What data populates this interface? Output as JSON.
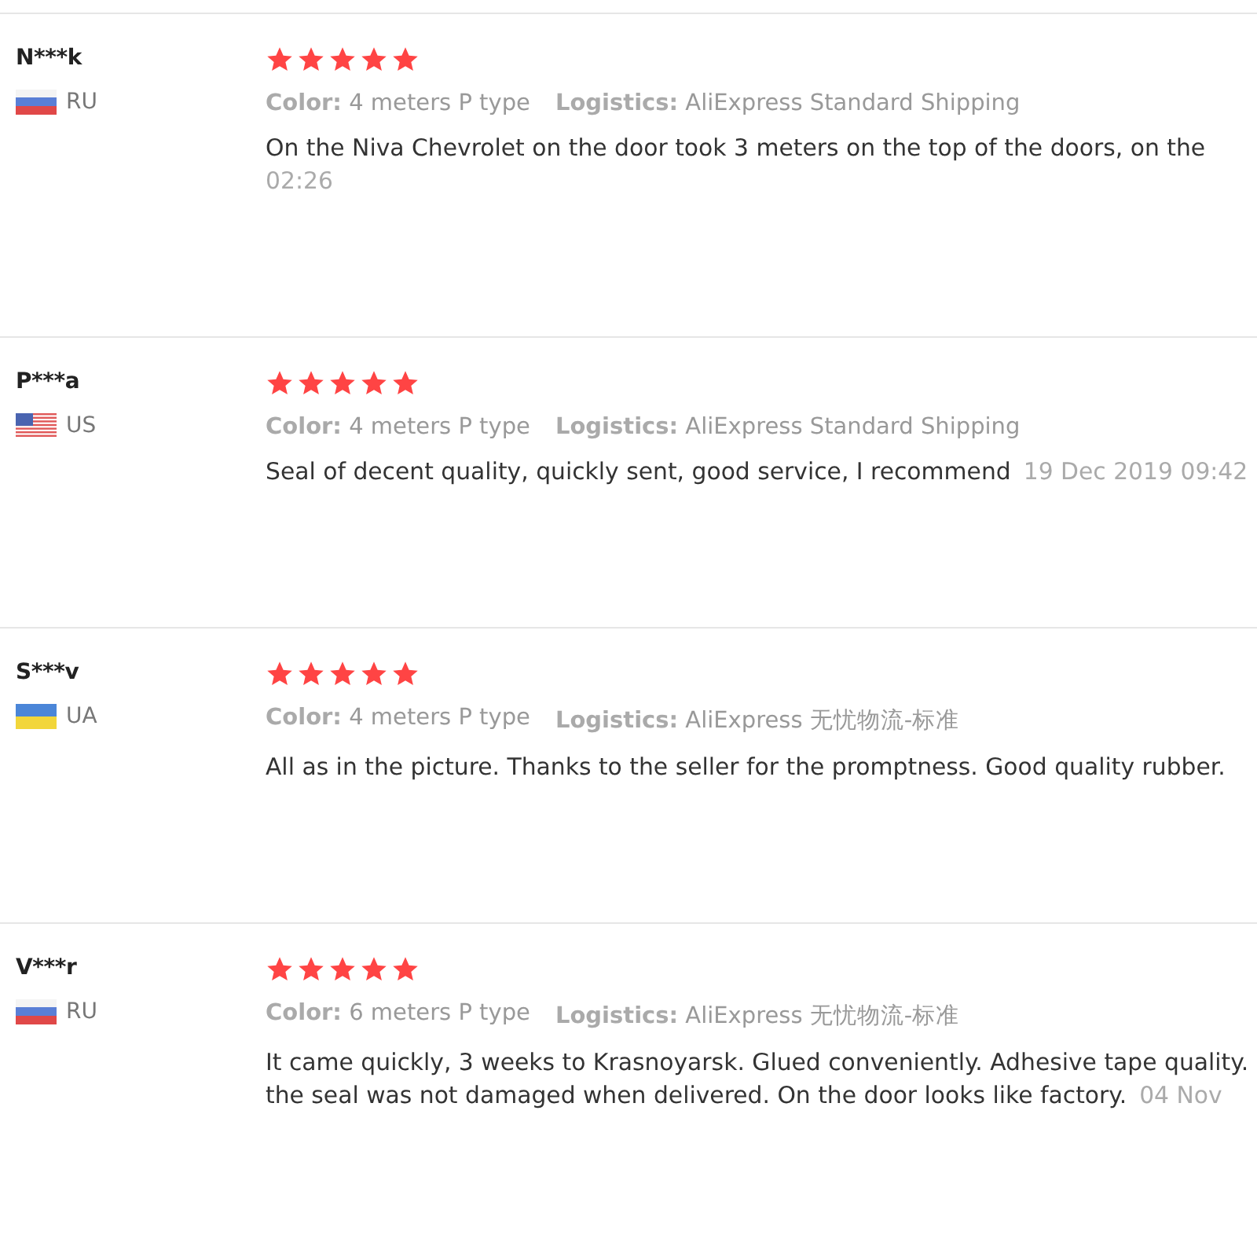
{
  "reviews": [
    {
      "name": "N***k",
      "kind": "ru",
      "country": "RU",
      "stars": 5,
      "color_label": "Color:",
      "color_value": "4 meters P type",
      "logistics_label": "Logistics:",
      "logistics_value": "AliExpress Standard Shipping",
      "lines": [
        [
          {
            "kind": "text",
            "text": "On the Niva Chevrolet on the door took 3 meters on the top of the doors, on the"
          }
        ],
        [
          {
            "kind": "date",
            "text": "02:26"
          }
        ]
      ]
    },
    {
      "name": "P***a",
      "kind": "us",
      "country": "US",
      "stars": 5,
      "color_label": "Color:",
      "color_value": "4 meters P type",
      "logistics_label": "Logistics:",
      "logistics_value": "AliExpress Standard Shipping",
      "lines": [
        [
          {
            "kind": "text",
            "text": "Seal of decent quality, quickly sent, good service, I recommend"
          },
          {
            "kind": "date",
            "text": "19 Dec 2019 09:42"
          }
        ]
      ]
    },
    {
      "name": "S***v",
      "kind": "ua",
      "country": "UA",
      "stars": 5,
      "color_label": "Color:",
      "color_value": "4 meters P type",
      "logistics_label": "Logistics:",
      "logistics_value": "AliExpress 无忧物流-标准",
      "lines": [
        [
          {
            "kind": "text",
            "text": "All as in the picture. Thanks to the seller for the promptness. Good quality rubber."
          }
        ]
      ]
    },
    {
      "name": "V***r",
      "kind": "ru",
      "country": "RU",
      "stars": 5,
      "color_label": "Color:",
      "color_value": "6 meters P type",
      "logistics_label": "Logistics:",
      "logistics_value": "AliExpress 无忧物流-标准",
      "lines": [
        [
          {
            "kind": "text",
            "text": "It came quickly, 3 weeks to Krasnoyarsk. Glued conveniently. Adhesive tape quality."
          }
        ],
        [
          {
            "kind": "text",
            "text": "the seal was not damaged when delivered. On the door looks like factory."
          },
          {
            "kind": "date",
            "text": "04 Nov"
          }
        ]
      ]
    }
  ]
}
